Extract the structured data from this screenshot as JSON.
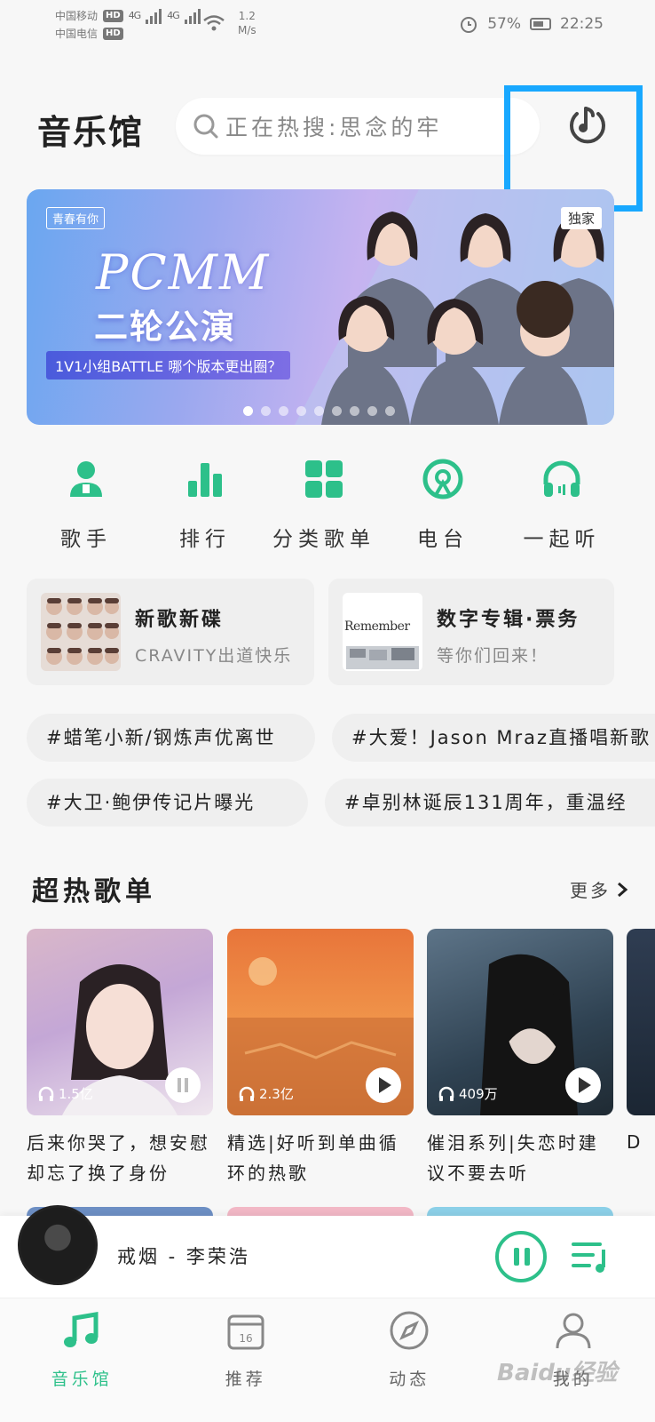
{
  "status": {
    "carrier1": "中国移动",
    "carrier2": "中国电信",
    "hd": "HD",
    "net": "4G",
    "speed_value": "1.2",
    "speed_unit": "M/s",
    "battery": "57%",
    "time": "22:25"
  },
  "header": {
    "title": "音乐馆",
    "search_placeholder": "正在热搜:思念的牢"
  },
  "banner": {
    "logo": "青春有你",
    "title": "PCMM",
    "subtitle": "二轮公演",
    "caption": "1V1小组BATTLE  哪个版本更出圈？",
    "tag": "独家"
  },
  "quicknav": [
    {
      "label": "歌手",
      "icon": "singer-icon"
    },
    {
      "label": "排行",
      "icon": "chart-icon"
    },
    {
      "label": "分类歌单",
      "icon": "category-icon"
    },
    {
      "label": "电台",
      "icon": "radio-icon"
    },
    {
      "label": "一起听",
      "icon": "headphones-icon"
    }
  ],
  "promos": [
    {
      "title": "新歌新碟",
      "subtitle": "CRAVITY出道快乐"
    },
    {
      "title": "数字专辑·票务",
      "subtitle": "等你们回来！",
      "cover_text": "Remember"
    }
  ],
  "hot_tags": [
    "#蜡笔小新/钢炼声优离世",
    "#大爱！Jason Mraz直播唱新歌",
    "#大卫·鲍伊传记片曝光",
    "#卓别林诞辰131周年，重温经"
  ],
  "section": {
    "title": "超热歌单",
    "more": "更多"
  },
  "playlists": [
    {
      "count": "1.5亿",
      "title": "后来你哭了，想安慰却忘了换了身份",
      "playing": true
    },
    {
      "count": "2.3亿",
      "title": "精选|好听到单曲循环的热歌",
      "playing": false
    },
    {
      "count": "409万",
      "title": "催泪系列|失恋时建议不要去听",
      "playing": false
    }
  ],
  "edge_text": "D",
  "player": {
    "track": "戒烟 - 李荣浩"
  },
  "tabs": [
    {
      "label": "音乐馆",
      "icon": "music-note-icon",
      "active": true
    },
    {
      "label": "推荐",
      "icon": "calendar-icon",
      "calendar_day": "16",
      "active": false
    },
    {
      "label": "动态",
      "icon": "compass-icon",
      "active": false
    },
    {
      "label": "我的",
      "icon": "profile-icon",
      "active": false
    }
  ],
  "watermark": "Baidu经验",
  "colors": {
    "accent": "#2dc08a",
    "highlight": "#18a8ff",
    "background": "#f7f7f7"
  }
}
